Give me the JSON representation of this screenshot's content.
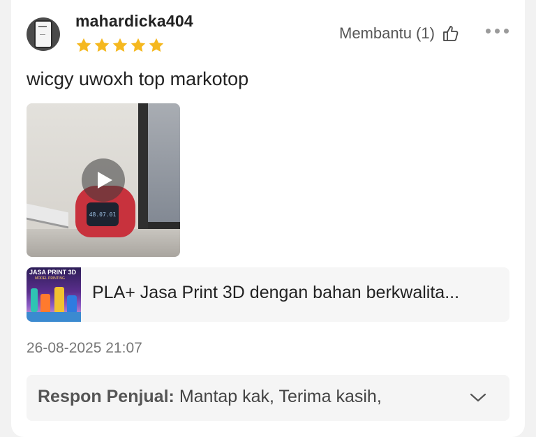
{
  "review": {
    "username": "mahardicka404",
    "rating": 5,
    "helpful_label": "Membantu (1)",
    "text": "wicgy uwoxh top markotop",
    "date": "26-08-2025 21:07",
    "video_screen_text": "48.07.01"
  },
  "product": {
    "name": "PLA+ Jasa Print 3D dengan bahan berkwalita...",
    "thumb_title": "JASA PRINT 3D",
    "thumb_subtitle": "MODEL PRINTING"
  },
  "seller_response": {
    "label": "Respon Penjual:",
    "text": " Mantap kak, Terima kasih,"
  },
  "colors": {
    "star": "#f5b81f",
    "text_primary": "#222222",
    "text_muted": "#777777",
    "panel_bg": "#f5f5f5"
  },
  "icons": [
    "avatar",
    "star-icon",
    "thumbs-up-icon",
    "more-icon",
    "play-icon",
    "chevron-down-icon"
  ]
}
